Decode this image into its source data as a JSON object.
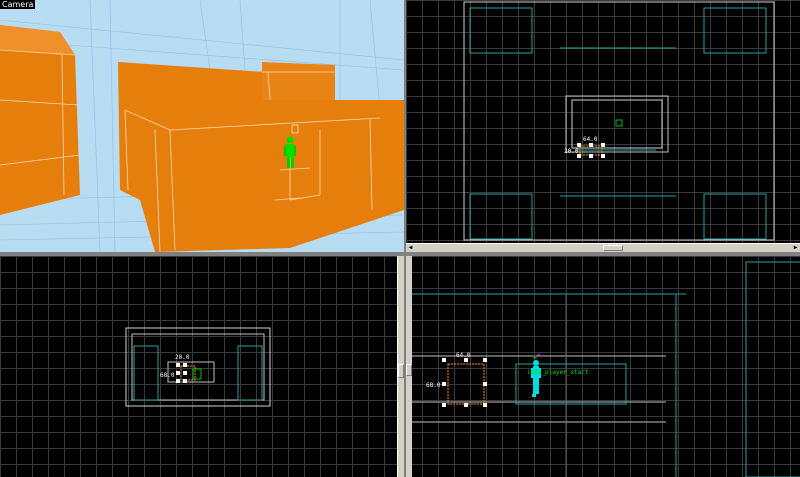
{
  "camera_view": {
    "label": "Camera"
  },
  "top_view": {
    "dimension_width": "64.0",
    "dimension_height": "20.0"
  },
  "front_view": {
    "dimension_width": "20.0",
    "dimension_height": "68.0"
  },
  "side_view": {
    "dimension_width": "64.0",
    "dimension_height": "68.0",
    "entity_label": "info_player_start"
  },
  "colors": {
    "brush_orange": "#e67e0c",
    "sky_blue": "#b8dcf2",
    "entity_green": "#00e000",
    "entity_cyan": "#00dcdc",
    "selection_dashed": "#ff8c00",
    "wire_teal": "#2aa0a0",
    "handle_white": "#ffffff"
  }
}
